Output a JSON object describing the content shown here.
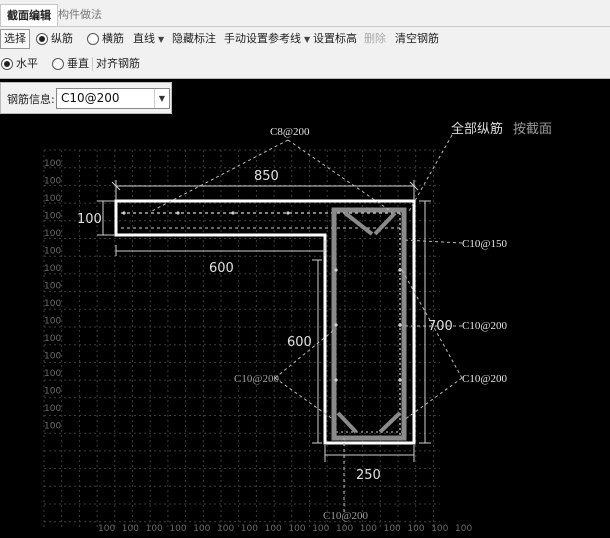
{
  "tabs": [
    {
      "label": "截面编辑",
      "active": true
    },
    {
      "label": "构件做法",
      "active": false
    }
  ],
  "toolbar": {
    "select": "选择",
    "longitudinal": "纵筋",
    "stirrup": "横筋",
    "line": "直线",
    "hide_annotation": "隐藏标注",
    "manual_reference_line": "手动设置参考线",
    "set_elevation": "设置标高",
    "delete": "删除",
    "clear_rebar": "清空钢筋"
  },
  "toolbar2": {
    "horizontal": "水平",
    "vertical": "垂直",
    "align_rebar": "对齐钢筋"
  },
  "rebar_info": {
    "label": "钢筋信息:",
    "value": "C10@200"
  },
  "drawing": {
    "header_all_long": "全部纵筋",
    "header_by_section": "按截面",
    "dims": {
      "top_width": "850",
      "flange_thickness": "100",
      "flange_inner": "600",
      "web_height_left": "600",
      "web_height_right": "700",
      "web_width": "250"
    },
    "rebar_labels": {
      "stirrup_top": "C8@200",
      "right_upper": "C10@150",
      "right_mid": "C10@200",
      "right_lower": "C10@200",
      "left_mid": "C10@200",
      "bottom": "C10@200"
    },
    "grid_left_labels": [
      "100",
      "100",
      "100",
      "100",
      "100",
      "100",
      "100",
      "100",
      "100",
      "100",
      "100",
      "100",
      "100",
      "100",
      "100",
      "100"
    ],
    "grid_bottom_labels": [
      "100",
      "100",
      "100",
      "100",
      "100",
      "100",
      "100",
      "100",
      "100",
      "100",
      "100",
      "100",
      "100",
      "100",
      "100",
      "100"
    ],
    "colors": {
      "background": "#000000",
      "grid": "#4a4a4a",
      "section": "#ffffff",
      "rebar": "#cfcfcf",
      "annotation": "#d8d8d8"
    }
  }
}
